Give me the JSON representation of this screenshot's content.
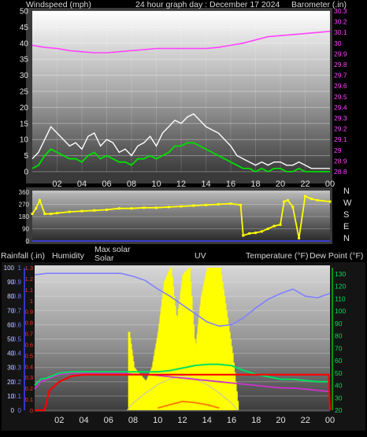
{
  "header": {
    "left": "Windspeed (mph)",
    "center": "24 hour graph day : December 17 2024",
    "right": "Barometer (.in)"
  },
  "middle_header": {
    "rain": "Rainfall (.in)",
    "humidity": "Humidity",
    "maxsolar": "Max solar",
    "solar": "Solar",
    "uv": "UV",
    "temp": "Temperature (°F)",
    "dew": "Dew Point (°F)"
  },
  "x_ticks": [
    "02",
    "04",
    "06",
    "08",
    "10",
    "12",
    "14",
    "16",
    "18",
    "20",
    "22",
    "00"
  ],
  "colors": {
    "wind_gust": "#ffffff",
    "wind_avg": "#00e000",
    "barometer": "#ff44ff",
    "wind_dir": "#ffff00",
    "humidity": "#8080ff",
    "solar": "#ffff00",
    "uv": "#ff8000",
    "temperature": "#00e060",
    "dewpoint": "#cc33cc",
    "rainfall": "#ff0000",
    "maxsolar": "#c0c0c0"
  },
  "chart_data": [
    {
      "type": "line",
      "title": "24 hour graph day : December 17 2024",
      "ylabel_left": "Windspeed (mph)",
      "ylabel_right": "Barometer (.in)",
      "x_range": [
        0,
        24
      ],
      "y_left_ticks": [
        "0",
        "5",
        "10",
        "15",
        "20",
        "25",
        "30",
        "35",
        "40",
        "45",
        "50"
      ],
      "y_left_range": [
        0,
        50
      ],
      "y_right_ticks": [
        "28.8",
        "28.9",
        "29",
        "29.1",
        "29.2",
        "29.3",
        "29.4",
        "29.5",
        "29.6",
        "29.7",
        "29.8",
        "29.9",
        "30",
        "30.1",
        "30.2",
        "30.3"
      ],
      "y_right_range": [
        28.8,
        30.3
      ],
      "series": [
        {
          "name": "Windspeed gust",
          "axis": "left",
          "x": [
            0,
            0.5,
            1,
            1.5,
            2,
            2.5,
            3,
            3.5,
            4,
            4.5,
            5,
            5.5,
            6,
            6.5,
            7,
            7.5,
            8,
            8.5,
            9,
            9.5,
            10,
            10.5,
            11,
            11.5,
            12,
            12.5,
            13,
            13.5,
            14,
            14.5,
            15,
            15.5,
            16,
            16.5,
            17,
            17.5,
            18,
            18.5,
            19,
            19.5,
            20,
            20.5,
            21,
            21.5,
            22,
            22.5,
            23,
            23.5,
            24
          ],
          "y": [
            4,
            6,
            10,
            14,
            12,
            10,
            8,
            9,
            7,
            11,
            12,
            8,
            10,
            9,
            6,
            7,
            5,
            8,
            9,
            11,
            8,
            12,
            14,
            16,
            15,
            17,
            18,
            16,
            14,
            13,
            12,
            10,
            8,
            5,
            4,
            3,
            2,
            3,
            2,
            3,
            3,
            2,
            2,
            3,
            2,
            1,
            1,
            1,
            1
          ]
        },
        {
          "name": "Windspeed average",
          "axis": "left",
          "x": [
            0,
            0.5,
            1,
            1.5,
            2,
            2.5,
            3,
            3.5,
            4,
            4.5,
            5,
            5.5,
            6,
            6.5,
            7,
            7.5,
            8,
            8.5,
            9,
            9.5,
            10,
            10.5,
            11,
            11.5,
            12,
            12.5,
            13,
            13.5,
            14,
            14.5,
            15,
            15.5,
            16,
            16.5,
            17,
            17.5,
            18,
            18.5,
            19,
            19.5,
            20,
            20.5,
            21,
            21.5,
            22,
            22.5,
            23,
            23.5,
            24
          ],
          "y": [
            1,
            2,
            5,
            7,
            6,
            5,
            4,
            4,
            3,
            5,
            6,
            4,
            5,
            4,
            3,
            3,
            2,
            4,
            4,
            5,
            4,
            5,
            6,
            8,
            8,
            9,
            9,
            8,
            7,
            6,
            5,
            4,
            3,
            2,
            1,
            1,
            0,
            1,
            0,
            1,
            1,
            0,
            0,
            1,
            0,
            0,
            0,
            0,
            0
          ]
        },
        {
          "name": "Barometer",
          "axis": "right",
          "x": [
            0,
            1,
            2,
            3,
            4,
            5,
            6,
            7,
            8,
            9,
            10,
            11,
            12,
            13,
            14,
            15,
            16,
            17,
            18,
            19,
            20,
            21,
            22,
            23,
            24
          ],
          "y": [
            29.98,
            29.96,
            29.95,
            29.93,
            29.92,
            29.91,
            29.91,
            29.92,
            29.93,
            29.94,
            29.95,
            29.95,
            29.95,
            29.95,
            29.95,
            29.96,
            29.98,
            30.0,
            30.03,
            30.06,
            30.07,
            30.08,
            30.09,
            30.1,
            30.11
          ]
        }
      ]
    },
    {
      "type": "scatter",
      "ylabel_right": [
        "N",
        "W",
        "S",
        "E",
        "N"
      ],
      "x_range": [
        0,
        24
      ],
      "y_ticks": [
        "0",
        "90",
        "180",
        "270",
        "360"
      ],
      "y_range": [
        0,
        360
      ],
      "series": [
        {
          "name": "Wind direction",
          "x": [
            0,
            0.3,
            0.6,
            1,
            1.5,
            2,
            3,
            4,
            5,
            6,
            7,
            8,
            9,
            10,
            11,
            12,
            13,
            14,
            15,
            16,
            16.8,
            17,
            17.5,
            18,
            18.5,
            19,
            19.5,
            20,
            20.3,
            20.6,
            21,
            21.5,
            22,
            22.5,
            23,
            24
          ],
          "y": [
            200,
            240,
            300,
            200,
            200,
            205,
            215,
            220,
            225,
            230,
            240,
            240,
            245,
            245,
            250,
            255,
            260,
            265,
            270,
            275,
            265,
            40,
            55,
            60,
            70,
            90,
            110,
            120,
            290,
            300,
            250,
            20,
            330,
            310,
            300,
            290
          ]
        }
      ]
    },
    {
      "type": "line",
      "ylabel_left": "Rainfall (.in)",
      "ylabel_right": "Temperature (°F)",
      "x_range": [
        0,
        24
      ],
      "rain_ticks": [
        "0",
        "0.1",
        "0.2",
        "0.3",
        "0.4",
        "0.5",
        "0.6",
        "0.7",
        "0.8",
        "0.9",
        "1"
      ],
      "rain_range": [
        0,
        1
      ],
      "humidity_ticks": [
        "0",
        "10",
        "20",
        "30",
        "40",
        "50",
        "60",
        "70",
        "80",
        "90",
        "100"
      ],
      "humidity_range": [
        0,
        100
      ],
      "uv_ticks": [
        "0",
        "0.1",
        "0.2",
        "0.3",
        "0.4",
        "0.5",
        "0.6",
        "0.7",
        "0.8",
        "0.9",
        "1",
        "1.1",
        "1.2",
        "1.3"
      ],
      "uv_range": [
        0,
        1.3
      ],
      "temp_ticks": [
        "20",
        "30",
        "40",
        "50",
        "60",
        "70",
        "80",
        "90",
        "100",
        "110",
        "120",
        "130"
      ],
      "temp_range": [
        20,
        135
      ],
      "series": [
        {
          "name": "Humidity",
          "axis": "humidity",
          "x": [
            0,
            1,
            2,
            3,
            4,
            5,
            6,
            7,
            8,
            9,
            10,
            11,
            12,
            13,
            14,
            15,
            16,
            17,
            18,
            19,
            20,
            21,
            22,
            23,
            24
          ],
          "y": [
            95,
            96,
            96,
            96,
            96,
            96,
            96,
            96,
            94,
            91,
            85,
            80,
            74,
            68,
            62,
            59,
            60,
            65,
            72,
            78,
            82,
            85,
            80,
            79,
            82
          ]
        },
        {
          "name": "Solar",
          "axis": "solar",
          "x": [
            7.6,
            8,
            8.5,
            9,
            9.5,
            10,
            10.5,
            11,
            11.5,
            12,
            12.5,
            13,
            13.5,
            14,
            14.5,
            15,
            15.5,
            16,
            16.5
          ],
          "y": [
            0.55,
            0.3,
            0.25,
            0.2,
            0.3,
            0.55,
            0.9,
            1.0,
            0.6,
            0.95,
            1.0,
            0.4,
            0.8,
            1.0,
            1.0,
            1.0,
            0.7,
            0.4,
            0
          ]
        },
        {
          "name": "UV",
          "axis": "uv",
          "x": [
            10,
            11,
            12,
            13,
            14,
            15
          ],
          "y": [
            0.02,
            0.05,
            0.08,
            0.07,
            0.05,
            0.02
          ]
        },
        {
          "name": "Max solar",
          "axis": "solar",
          "x": [
            7.5,
            8,
            9,
            10,
            11,
            12,
            13,
            14,
            15,
            16,
            16.5
          ],
          "y": [
            0,
            0.05,
            0.12,
            0.18,
            0.22,
            0.24,
            0.22,
            0.18,
            0.12,
            0.05,
            0
          ]
        },
        {
          "name": "Temperature",
          "axis": "temp",
          "x": [
            0,
            0.5,
            1,
            1.5,
            2,
            3,
            4,
            5,
            6,
            7,
            8,
            9,
            10,
            11,
            12,
            13,
            14,
            15,
            16,
            17,
            18,
            19,
            20,
            21,
            22,
            23,
            24
          ],
          "y": [
            40,
            45,
            46,
            48,
            50,
            51,
            51,
            51,
            51,
            51,
            51,
            51,
            51,
            52,
            54,
            56,
            57,
            57,
            56,
            52,
            49,
            47,
            45,
            45,
            44,
            43,
            43
          ]
        },
        {
          "name": "Dew Point",
          "axis": "temp",
          "x": [
            0,
            0.5,
            1,
            1.5,
            2,
            3,
            4,
            5,
            6,
            7,
            8,
            9,
            10,
            11,
            12,
            13,
            14,
            15,
            16,
            17,
            18,
            19,
            20,
            21,
            22,
            23,
            24
          ],
          "y": [
            37,
            43,
            45,
            47,
            49,
            50,
            50,
            50,
            50,
            50,
            49,
            49,
            48,
            47,
            46,
            45,
            44,
            43,
            42,
            41,
            40,
            39,
            38,
            38,
            37,
            36,
            35
          ]
        },
        {
          "name": "Rainfall",
          "axis": "rain",
          "x": [
            0,
            0.8,
            1.2,
            2,
            3,
            4,
            5,
            6,
            7,
            8,
            9,
            10,
            11,
            12,
            13,
            14,
            15,
            16,
            17,
            18,
            19,
            20,
            21,
            22,
            23,
            23.9,
            24
          ],
          "y": [
            0,
            0,
            0.14,
            0.2,
            0.24,
            0.25,
            0.25,
            0.25,
            0.25,
            0.25,
            0.25,
            0.25,
            0.25,
            0.25,
            0.25,
            0.25,
            0.25,
            0.25,
            0.25,
            0.25,
            0.25,
            0.25,
            0.25,
            0.25,
            0.25,
            0.25,
            0
          ]
        }
      ]
    }
  ]
}
